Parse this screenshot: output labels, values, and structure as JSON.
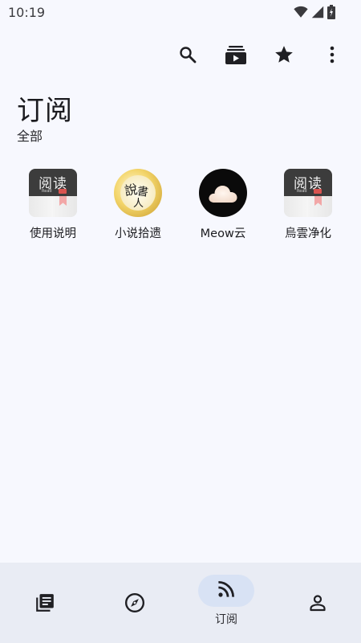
{
  "status_bar": {
    "time": "10:19",
    "icons": [
      "wifi-icon",
      "signal-icon",
      "battery-icon"
    ]
  },
  "toolbar": {
    "actions": [
      "search-icon",
      "rss-source-icon",
      "star-icon",
      "more-vert-icon"
    ]
  },
  "header": {
    "title": "订阅",
    "subtitle": "全部"
  },
  "subscriptions": [
    {
      "label": "使用说明",
      "icon": "legado-book-icon",
      "icon_text": "阅读",
      "icon_subtext": "Read"
    },
    {
      "label": "小说拾遗",
      "icon": "gold-coin-calligraphy-icon",
      "icon_text_1": "說",
      "icon_text_2": "書",
      "icon_text_3": "人"
    },
    {
      "label": "Meow云",
      "icon": "cloud-icon"
    },
    {
      "label": "烏雲净化",
      "icon": "legado-book-icon",
      "icon_text": "阅读",
      "icon_subtext": "Read"
    }
  ],
  "bottom_nav": {
    "items": [
      {
        "icon": "bookshelf-icon",
        "label": ""
      },
      {
        "icon": "compass-icon",
        "label": ""
      },
      {
        "icon": "rss-icon",
        "label": "订阅",
        "selected": true
      },
      {
        "icon": "person-icon",
        "label": ""
      }
    ]
  },
  "colors": {
    "background": "#f7f8fe",
    "nav_background": "#e9ecf4",
    "nav_selected_pill": "#d8e2f4",
    "icon_dark": "#1f1f23"
  }
}
